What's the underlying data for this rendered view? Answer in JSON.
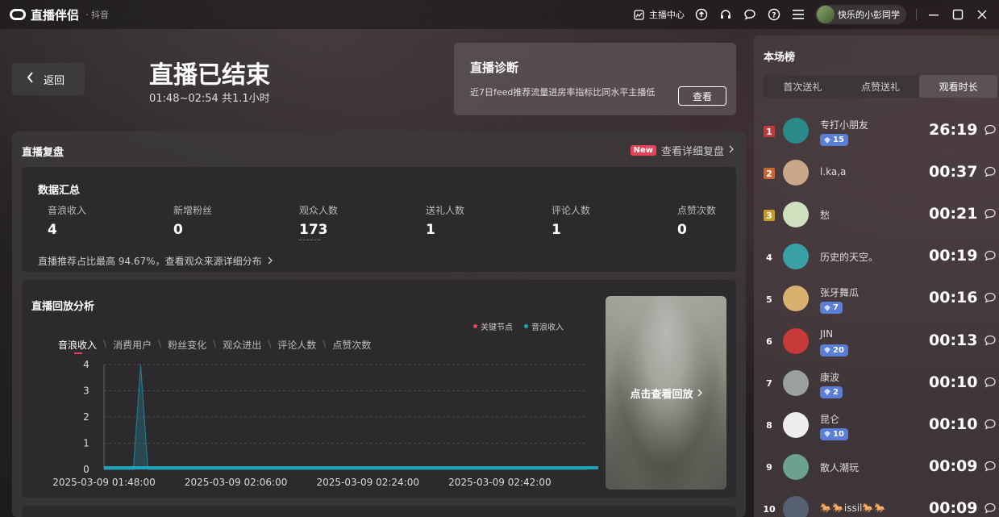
{
  "titlebar": {
    "app_name": "直播伴侣",
    "app_sub": "· 抖音",
    "anchor_center": "主播中心",
    "username": "快乐的小彭同学"
  },
  "header": {
    "back": "返回",
    "title": "直播已结束",
    "time_range": "01:48~02:54 共1.1小时"
  },
  "diagnosis": {
    "title": "直播诊断",
    "text": "近7日feed推荐流量进房率指标比同水平主播低",
    "button": "查看"
  },
  "review": {
    "title": "直播复盘",
    "new_badge": "New",
    "detail_link": "查看详细复盘"
  },
  "summary": {
    "title": "数据汇总",
    "stats": [
      {
        "label": "音浪收入",
        "value": "4"
      },
      {
        "label": "新增粉丝",
        "value": "0"
      },
      {
        "label": "观众人数",
        "value": "173"
      },
      {
        "label": "送礼人数",
        "value": "1"
      },
      {
        "label": "评论人数",
        "value": "1"
      },
      {
        "label": "点赞次数",
        "value": "0"
      }
    ],
    "note": "直播推荐占比最高 94.67%，查看观众来源详细分布"
  },
  "analysis": {
    "title": "直播回放分析",
    "tabs": [
      "音浪收入",
      "消费用户",
      "粉丝变化",
      "观众进出",
      "评论人数",
      "点赞次数"
    ],
    "legend": [
      "关键节点",
      "音浪收入"
    ],
    "replay": "点击查看回放"
  },
  "chart_data": {
    "type": "area",
    "x_ticks": [
      "2025-03-09 01:48:00",
      "2025-03-09 02:06:00",
      "2025-03-09 02:24:00",
      "2025-03-09 02:42:00"
    ],
    "y_ticks": [
      "4",
      "3",
      "2",
      "1",
      "0"
    ],
    "ylim": [
      0,
      4
    ],
    "series": [
      {
        "name": "音浪收入",
        "x": [
          "2025-03-09 01:48:00",
          "2025-03-09 01:52:00",
          "2025-03-09 01:53:00",
          "2025-03-09 01:54:00",
          "2025-03-09 02:54:00"
        ],
        "values": [
          0,
          0,
          4,
          0,
          0
        ]
      }
    ],
    "colors": {
      "series": "#1fa3b8",
      "key_point": "#e8425a"
    },
    "grid": true
  },
  "board": {
    "title": "本场榜",
    "tabs": [
      "首次送礼",
      "点赞送礼",
      "观看时长"
    ],
    "rows": [
      {
        "rank": "1",
        "name": "专打小朋友",
        "badge": "15",
        "duration": "26:19"
      },
      {
        "rank": "2",
        "name": "l.ka,a",
        "badge": "",
        "duration": "00:37"
      },
      {
        "rank": "3",
        "name": "愁",
        "badge": "",
        "duration": "00:21"
      },
      {
        "rank": "4",
        "name": "历史的天空。",
        "badge": "",
        "duration": "00:19"
      },
      {
        "rank": "5",
        "name": "张牙舞瓜",
        "badge": "7",
        "duration": "00:16"
      },
      {
        "rank": "6",
        "name": "JIN",
        "badge": "20",
        "duration": "00:13"
      },
      {
        "rank": "7",
        "name": "康波",
        "badge": "2",
        "duration": "00:10"
      },
      {
        "rank": "8",
        "name": "昆仑",
        "badge": "10",
        "duration": "00:10"
      },
      {
        "rank": "9",
        "name": "散人潮玩",
        "badge": "",
        "duration": "00:09"
      },
      {
        "rank": "10",
        "name": "🐎🐎issil🐎🐎",
        "badge": "",
        "duration": "00:09"
      }
    ],
    "rank_colors": [
      "#c23a3a",
      "#c9652e",
      "#c79a2a"
    ],
    "avatar_colors": [
      "#2a8a8a",
      "#caa68a",
      "#cfe0bf",
      "#3aa0a8",
      "#d8b070",
      "#c83a3a",
      "#9aa0a0",
      "#eeeeee",
      "#6ca090",
      "#556070"
    ]
  }
}
